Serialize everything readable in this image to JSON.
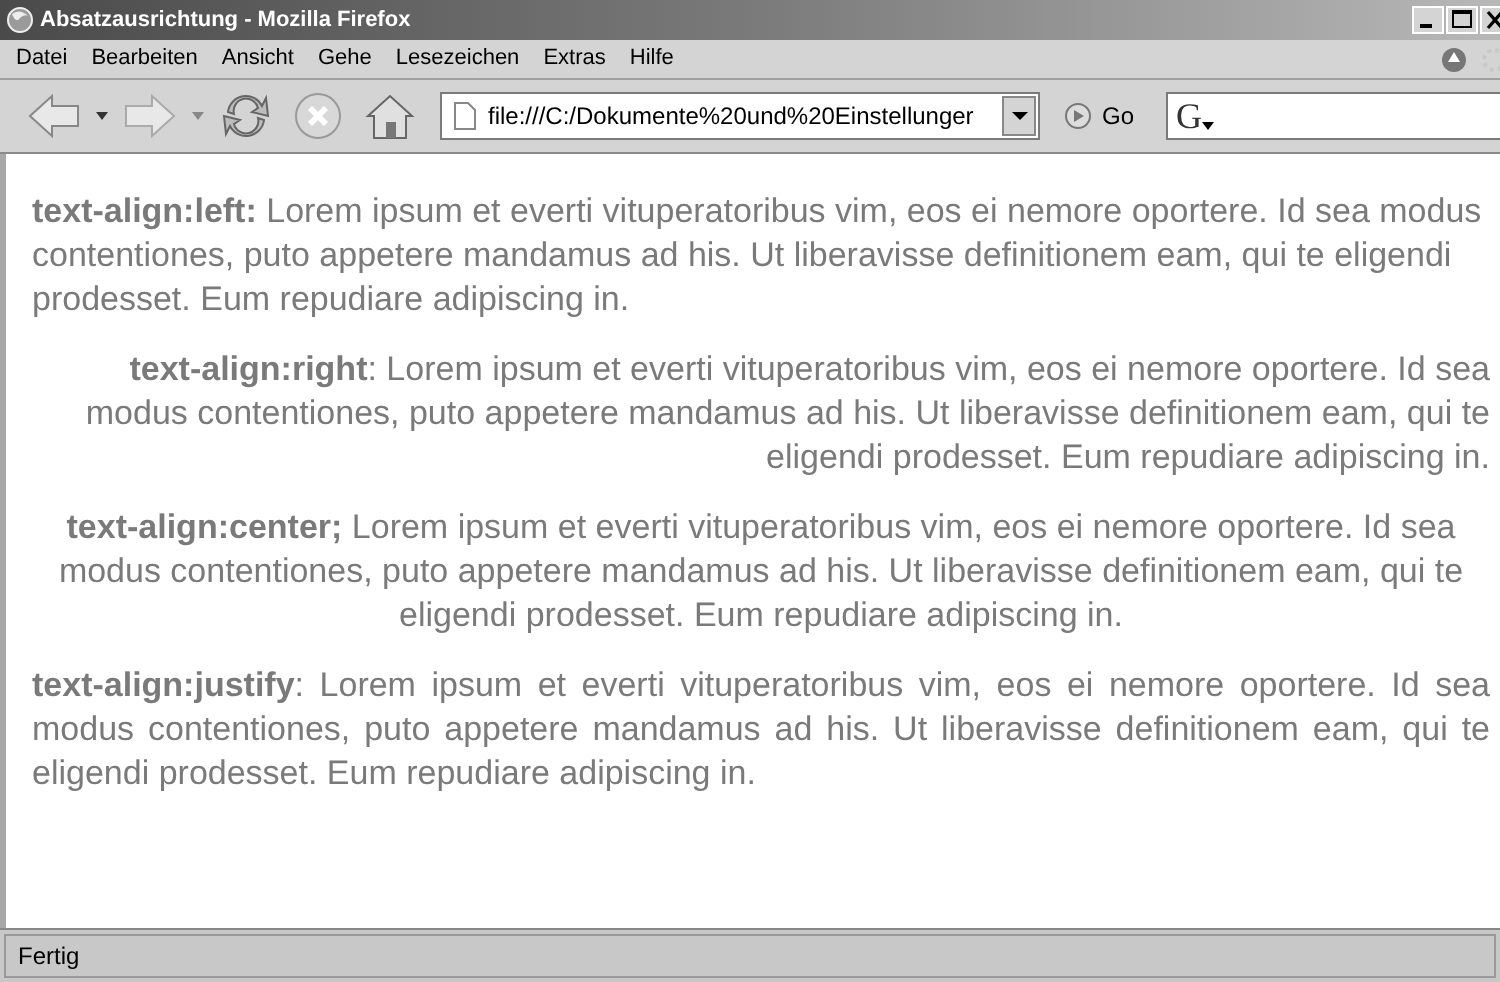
{
  "window": {
    "title": "Absatzausrichtung - Mozilla Firefox"
  },
  "menu": [
    "Datei",
    "Bearbeiten",
    "Ansicht",
    "Gehe",
    "Lesezeichen",
    "Extras",
    "Hilfe"
  ],
  "toolbar": {
    "address": "file:///C:/Dokumente%20und%20Einstellunger",
    "go": "Go",
    "search_logo": "G"
  },
  "paragraphs": [
    {
      "kind": "left",
      "text": "**text-align:left:** Lorem ipsum et everti vituperatoribus vim, eos ei nemore oportere. Id sea modus contentiones, puto appetere mandamus ad his. Ut liberavisse definitionem eam, qui te eligendi prodesset. Eum repudiare adipiscing in."
    },
    {
      "kind": "right",
      "text": "**text-align:right**: Lorem ipsum et everti vituperatoribus vim, eos ei nemore oportere. Id sea modus contentiones, puto appetere mandamus ad his. Ut liberavisse definitionem eam, qui te eligendi prodesset. Eum repudiare adipiscing in."
    },
    {
      "kind": "center",
      "text": "**text-align:center;** Lorem ipsum et everti vituperatoribus vim, eos ei nemore oportere. Id sea modus contentiones, puto appetere mandamus ad his. Ut liberavisse definitionem eam, qui te eligendi prodesset. Eum repudiare adipiscing in."
    },
    {
      "kind": "justify",
      "text": "**text-align:justify**: Lorem ipsum et everti vituperatoribus vim, eos ei nemore oportere. Id sea modus contentiones, puto appetere mandamus ad his. Ut liberavisse definitionem eam, qui te eligendi prodesset. Eum repudiare adipiscing in."
    }
  ],
  "status_bar": {
    "text": "Fertig"
  }
}
